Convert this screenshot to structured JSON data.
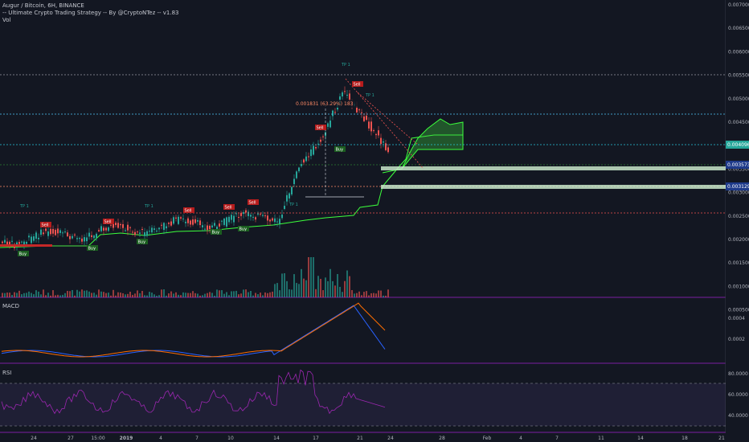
{
  "legend": {
    "symbol_line": "Augur / Bitcoin, 6H, BINANCE",
    "strategy_line": "-- Ultimate Crypto Trading Strategy -- By @CryptoNTez -- v1.83",
    "vol_label": "Vol"
  },
  "panes": {
    "macd_label": "MACD",
    "rsi_label": "RSI"
  },
  "price_axis": {
    "ticks": [
      "0.007000",
      "0.006500",
      "0.006000",
      "0.005500",
      "0.005000",
      "0.004500",
      "0.004000",
      "0.003500",
      "0.003000",
      "0.002500",
      "0.002000",
      "0.001500",
      "0.001000",
      "0.000500"
    ],
    "badges": [
      {
        "text": "0.004096",
        "color": "#26a69a"
      },
      {
        "text": "0.003573",
        "color": "#1e3a8a"
      },
      {
        "text": "0.003129",
        "color": "#1e3a8a"
      }
    ]
  },
  "macd_axis": {
    "ticks": [
      "0.0004",
      "0.0002"
    ]
  },
  "rsi_axis": {
    "ticks": [
      "80.0000",
      "60.0000",
      "40.0000"
    ]
  },
  "time_axis": {
    "ticks": [
      "24",
      "27",
      "15:00",
      "2019",
      "4",
      "7",
      "10",
      "14",
      "17",
      "21",
      "24",
      "28",
      "Feb",
      "4",
      "7",
      "11",
      "14",
      "18",
      "21"
    ]
  },
  "measure_label": "0.001831 (63.29%) 183",
  "signals": {
    "buy": "Buy",
    "sell": "Sell",
    "tp": "TP 1"
  },
  "colors": {
    "background": "#131722",
    "up": "#26a69a",
    "down": "#ef5350",
    "cloud": "#3cff3c",
    "macd_line": "#2962ff",
    "signal_line": "#ff6d00",
    "rsi_line": "#9c27b0",
    "pane_divider": "#7b1fa2"
  }
}
